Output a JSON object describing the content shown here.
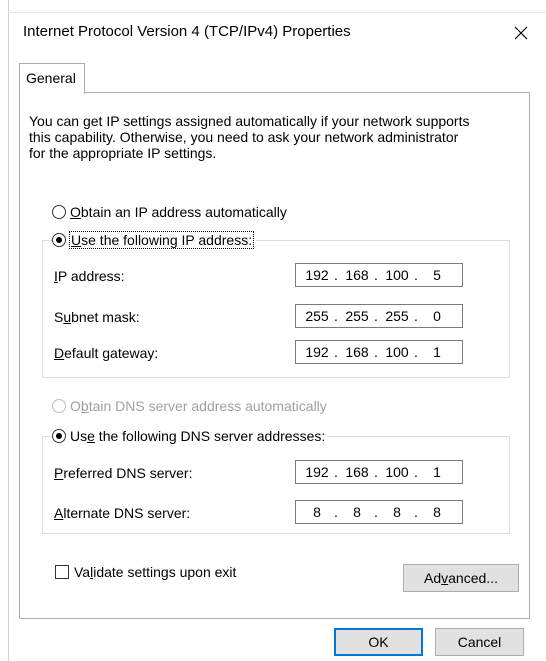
{
  "window": {
    "title": "Internet Protocol Version 4 (TCP/IPv4) Properties",
    "close_icon": "close-icon"
  },
  "tabs": [
    {
      "label": "General",
      "selected": true
    }
  ],
  "description": {
    "line1": "You can get IP settings assigned automatically if your network supports",
    "line2": "this capability. Otherwise, you need to ask your network administrator",
    "line3": "for the appropriate IP settings."
  },
  "ip_mode": {
    "auto": {
      "accel": "O",
      "rest": "btain an IP address automatically",
      "checked": false
    },
    "manual": {
      "accel": "U",
      "rest": "se the following IP address:",
      "checked": true
    }
  },
  "ip_fields": {
    "ip_address": {
      "pre": "",
      "accel": "I",
      "post": "P address:",
      "octets": [
        "192",
        "168",
        "100",
        "5"
      ]
    },
    "subnet_mask": {
      "pre": "S",
      "accel": "u",
      "post": "bnet mask:",
      "octets": [
        "255",
        "255",
        "255",
        "0"
      ]
    },
    "default_gateway": {
      "pre": "",
      "accel": "D",
      "post": "efault gateway:",
      "octets": [
        "192",
        "168",
        "100",
        "1"
      ]
    }
  },
  "dns_mode": {
    "auto": {
      "pre": "O",
      "accel": "b",
      "post": "tain DNS server address automatically",
      "checked": false,
      "enabled": false
    },
    "manual": {
      "pre": "Us",
      "accel": "e",
      "post": " the following DNS server addresses:",
      "checked": true
    }
  },
  "dns_fields": {
    "preferred": {
      "accel": "P",
      "post": "referred DNS server:",
      "octets": [
        "192",
        "168",
        "100",
        "1"
      ]
    },
    "alternate": {
      "accel": "A",
      "post": "lternate DNS server:",
      "octets": [
        "8",
        "8",
        "8",
        "8"
      ]
    }
  },
  "validate": {
    "pre": "Va",
    "accel": "l",
    "post": "idate settings upon exit",
    "checked": false
  },
  "buttons": {
    "advanced": {
      "pre": "Ad",
      "accel": "v",
      "post": "anced..."
    },
    "ok": "OK",
    "cancel": "Cancel"
  },
  "ip_separator": "."
}
